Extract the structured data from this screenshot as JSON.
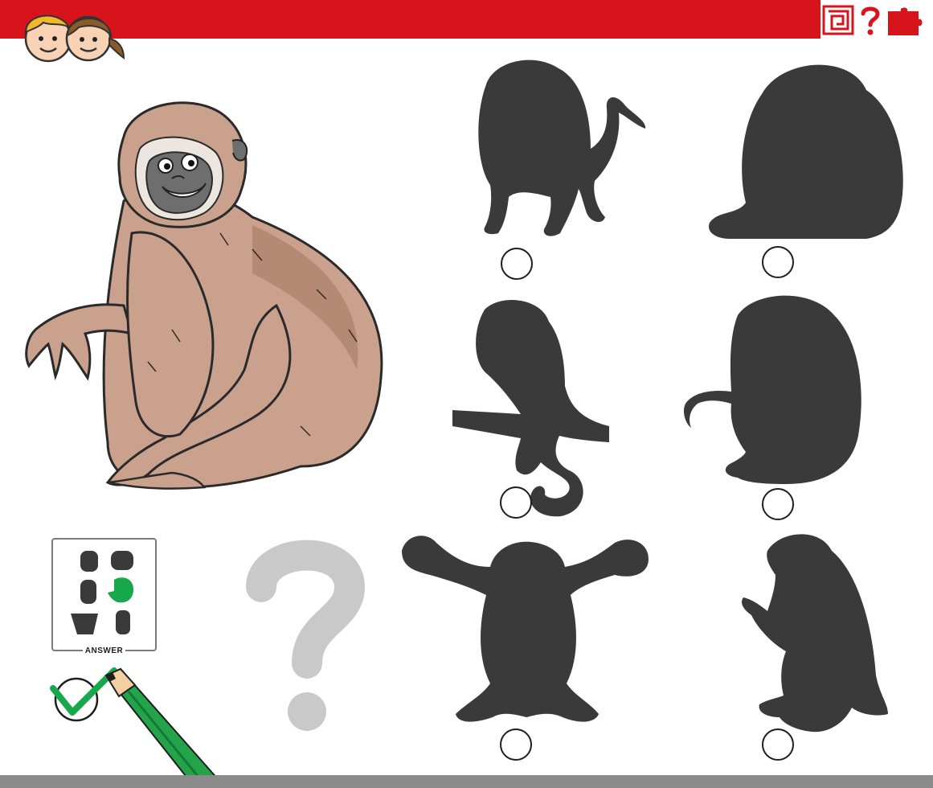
{
  "header": {
    "icons": [
      "maze-icon",
      "question-icon",
      "puzzle-icon"
    ],
    "accent_color": "#d7141c"
  },
  "main_picture": {
    "subject": "gibbon"
  },
  "options": [
    {
      "shape": "baboon"
    },
    {
      "shape": "sitting-ape"
    },
    {
      "shape": "monkey-on-branch"
    },
    {
      "shape": "gibbon"
    },
    {
      "shape": "arms-raised-monkey"
    },
    {
      "shape": "monkey-holding-stick"
    }
  ],
  "answer": {
    "label": "ANSWER",
    "correct_index": 3,
    "highlight_color": "#16a84a"
  },
  "colors": {
    "silhouette": "#3a3a3a",
    "question_mark": "#c9c9c9",
    "bottom_bar": "#8a8a8a"
  }
}
